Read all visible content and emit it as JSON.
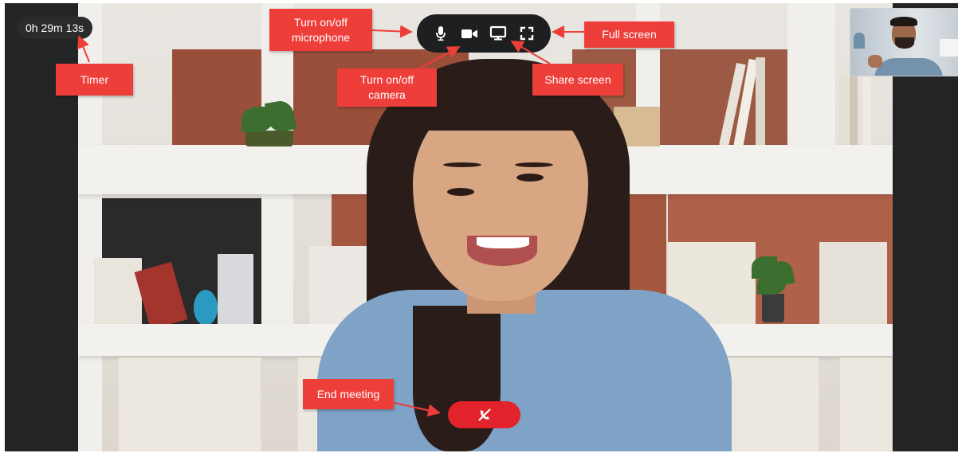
{
  "timer": {
    "text": "0h 29m 13s"
  },
  "controls": {
    "microphone_icon": "microphone-icon",
    "camera_icon": "video-camera-icon",
    "share_screen_icon": "monitor-icon",
    "fullscreen_icon": "fullscreen-icon",
    "end_meeting_icon": "phone-hangup-icon"
  },
  "annotations": {
    "microphone": "Turn on/off\nmicrophone",
    "timer": "Timer",
    "camera": "Turn on/off\ncamera",
    "share_screen": "Share screen",
    "full_screen": "Full screen",
    "end_meeting": "End meeting"
  },
  "colors": {
    "callout": "#ee3e3a",
    "end_button": "#e3232b",
    "control_bar": "#1e1f20",
    "background": "#222426"
  }
}
